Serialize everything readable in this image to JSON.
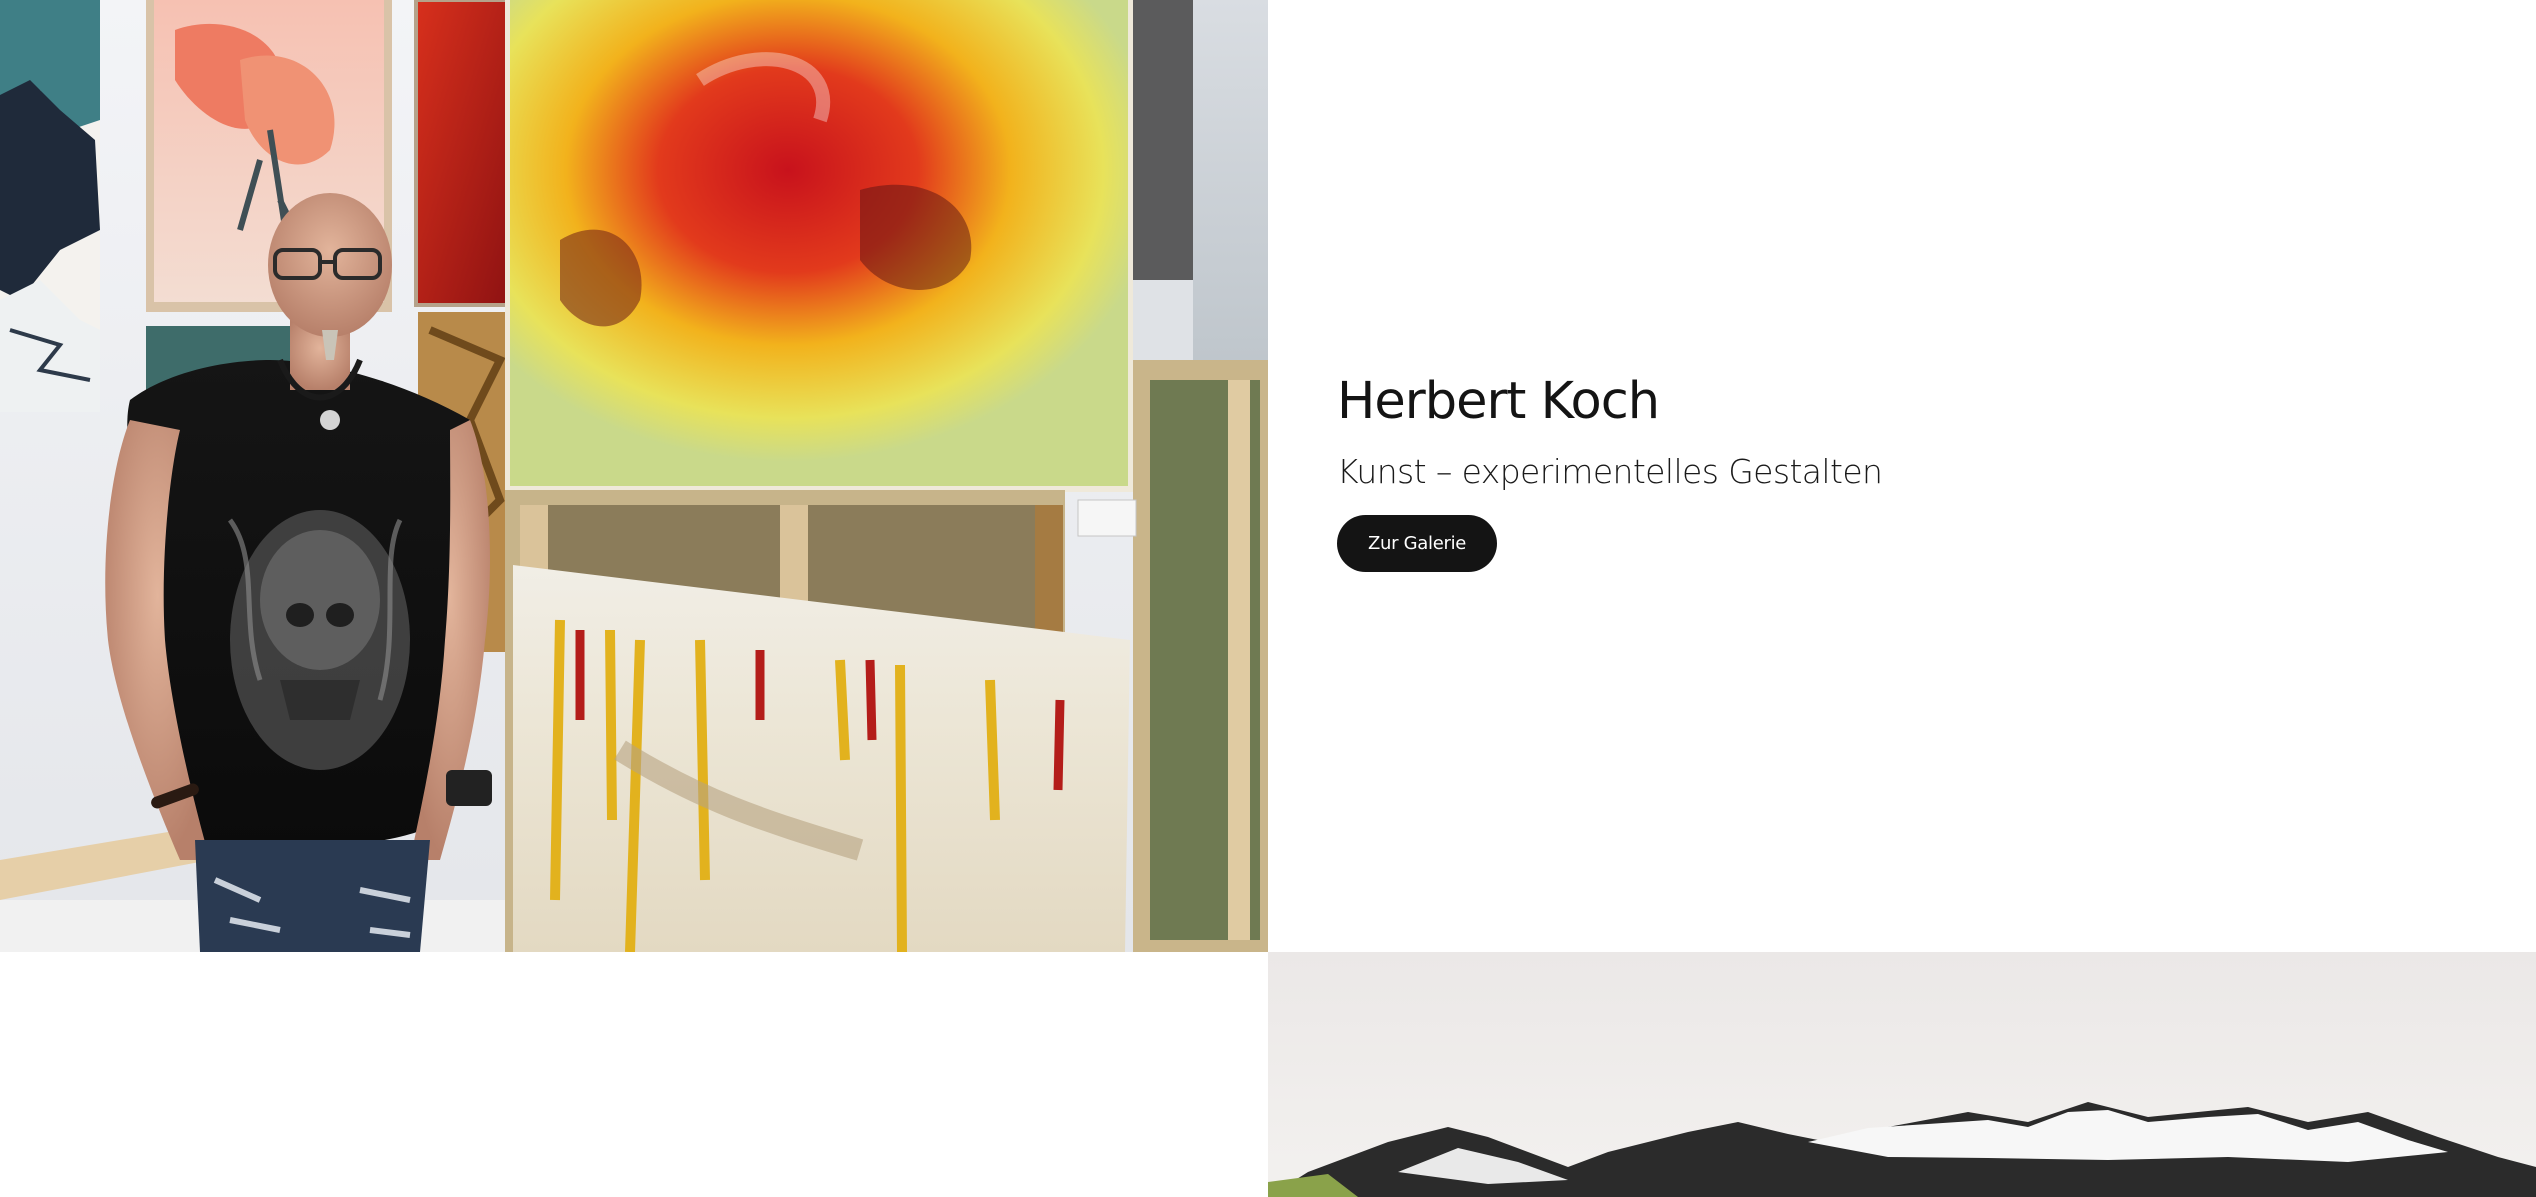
{
  "hero": {
    "title": "Herbert Koch",
    "subtitle": "Kunst – experimentelles Gestalten",
    "button_label": "Zur Galerie"
  },
  "images": {
    "hero_photo": "artist-in-gallery-photo",
    "mountain_photo": "mountain-painting-photo"
  },
  "colors": {
    "button_bg": "#141414",
    "button_text": "#ffffff",
    "title_text": "#141414"
  }
}
